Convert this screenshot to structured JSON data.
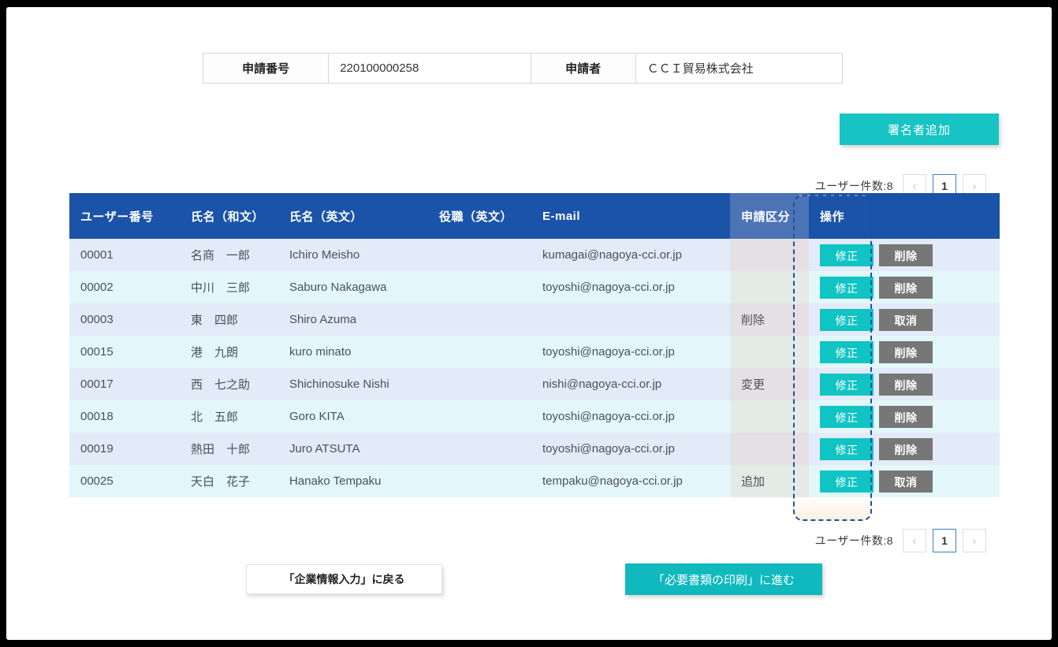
{
  "info": {
    "application_number_label": "申請番号",
    "application_number_value": "220100000258",
    "applicant_label": "申請者",
    "applicant_value": "ＣＣＩ貿易株式会社"
  },
  "toolbar": {
    "add_signer_label": "署名者追加"
  },
  "pagination": {
    "count_label": "ユーザー件数:8",
    "prev_label": "‹",
    "page_label": "1",
    "next_label": "›"
  },
  "grid": {
    "headers": {
      "user_no": "ユーザー番号",
      "name_jp": "氏名（和文）",
      "name_en": "氏名（英文）",
      "title_en": "役職（英文）",
      "email": "E-mail",
      "kubun": "申請区分",
      "operation": "操作"
    },
    "rows": [
      {
        "user_no": "00001",
        "name_jp": "名商　一郎",
        "name_en": "Ichiro Meisho",
        "title_en": "",
        "email": "kumagai@nagoya-cci.or.jp",
        "kubun": "",
        "edit": "修正",
        "delete": "削除"
      },
      {
        "user_no": "00002",
        "name_jp": "中川　三郎",
        "name_en": "Saburo Nakagawa",
        "title_en": "",
        "email": "toyoshi@nagoya-cci.or.jp",
        "kubun": "",
        "edit": "修正",
        "delete": "削除"
      },
      {
        "user_no": "00003",
        "name_jp": "東　四郎",
        "name_en": "Shiro Azuma",
        "title_en": "",
        "email": "",
        "kubun": "削除",
        "edit": "修正",
        "delete": "取消"
      },
      {
        "user_no": "00015",
        "name_jp": "港　九朗",
        "name_en": "kuro minato",
        "title_en": "",
        "email": "toyoshi@nagoya-cci.or.jp",
        "kubun": "",
        "edit": "修正",
        "delete": "削除"
      },
      {
        "user_no": "00017",
        "name_jp": "西　七之助",
        "name_en": "Shichinosuke Nishi",
        "title_en": "",
        "email": "nishi@nagoya-cci.or.jp",
        "kubun": "変更",
        "edit": "修正",
        "delete": "削除"
      },
      {
        "user_no": "00018",
        "name_jp": "北　五郎",
        "name_en": "Goro KITA",
        "title_en": "",
        "email": "toyoshi@nagoya-cci.or.jp",
        "kubun": "",
        "edit": "修正",
        "delete": "削除"
      },
      {
        "user_no": "00019",
        "name_jp": "熱田　十郎",
        "name_en": "Juro ATSUTA",
        "title_en": "",
        "email": "toyoshi@nagoya-cci.or.jp",
        "kubun": "",
        "edit": "修正",
        "delete": "削除"
      },
      {
        "user_no": "00025",
        "name_jp": "天白　花子",
        "name_en": "Hanako Tempaku",
        "title_en": "",
        "email": "tempaku@nagoya-cci.or.jp",
        "kubun": "追加",
        "edit": "修正",
        "delete": "取消"
      }
    ]
  },
  "footer": {
    "back_label": "「企業情報入力」に戻る",
    "next_label": "「必要書類の印刷」に進む"
  },
  "colors": {
    "header_blue": "#1b53a8",
    "kubun_header_blue": "#4c73b5",
    "teal": "#11c4c4",
    "gray_button": "#777777",
    "highlight_dash": "#14559e"
  }
}
